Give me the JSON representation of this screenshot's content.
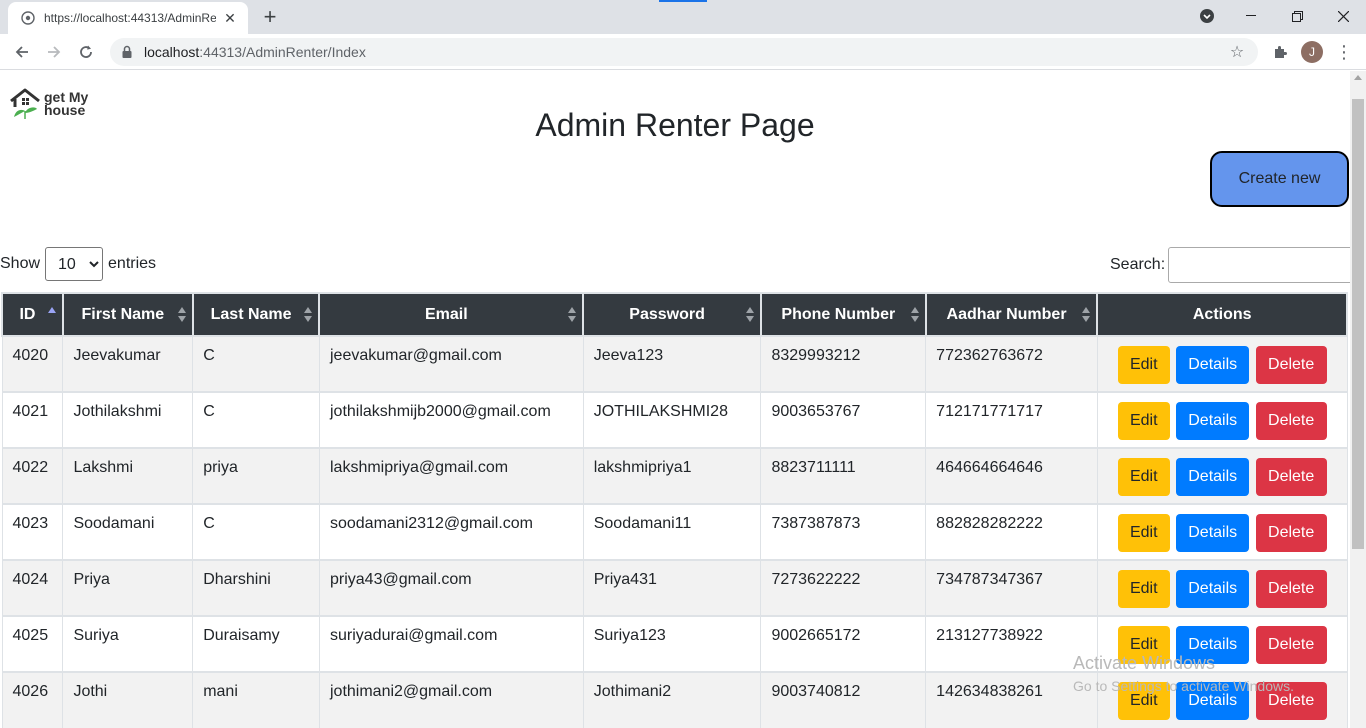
{
  "browser": {
    "tab_title": "https://localhost:44313/AdminRe",
    "url_host": "localhost",
    "url_rest": ":44313/AdminRenter/Index",
    "profile_initial": "J"
  },
  "page": {
    "logo_line1": "get My",
    "logo_line2": "house",
    "title": "Admin Renter Page",
    "create_label": "Create new",
    "show_label": "Show",
    "entries_label": "entries",
    "page_length": "10",
    "search_label": "Search:",
    "search_value": ""
  },
  "table": {
    "columns": [
      "ID",
      "First Name",
      "Last Name",
      "Email",
      "Password",
      "Phone Number",
      "Aadhar Number",
      "Actions"
    ],
    "rows": [
      {
        "id": "4020",
        "first": "Jeevakumar",
        "last": "C",
        "email": "jeevakumar@gmail.com",
        "password": "Jeeva123",
        "phone": "8329993212",
        "aadhar": "772362763672"
      },
      {
        "id": "4021",
        "first": "Jothilakshmi",
        "last": "C",
        "email": "jothilakshmijb2000@gmail.com",
        "password": "JOTHILAKSHMI28",
        "phone": "9003653767",
        "aadhar": "712171771717"
      },
      {
        "id": "4022",
        "first": "Lakshmi",
        "last": "priya",
        "email": "lakshmipriya@gmail.com",
        "password": "lakshmipriya1",
        "phone": "8823711111",
        "aadhar": "464664664646"
      },
      {
        "id": "4023",
        "first": "Soodamani",
        "last": "C",
        "email": "soodamani2312@gmail.com",
        "password": "Soodamani11",
        "phone": "7387387873",
        "aadhar": "882828282222"
      },
      {
        "id": "4024",
        "first": "Priya",
        "last": "Dharshini",
        "email": "priya43@gmail.com",
        "password": "Priya431",
        "phone": "7273622222",
        "aadhar": "734787347367"
      },
      {
        "id": "4025",
        "first": "Suriya",
        "last": "Duraisamy",
        "email": "suriyadurai@gmail.com",
        "password": "Suriya123",
        "phone": "9002665172",
        "aadhar": "213127738922"
      },
      {
        "id": "4026",
        "first": "Jothi",
        "last": "mani",
        "email": "jothimani2@gmail.com",
        "password": "Jothimani2",
        "phone": "9003740812",
        "aadhar": "142634838261"
      }
    ],
    "action_labels": {
      "edit": "Edit",
      "details": "Details",
      "delete": "Delete"
    }
  },
  "watermark": {
    "line1": "Activate Windows",
    "line2": "Go to Settings to activate Windows."
  }
}
